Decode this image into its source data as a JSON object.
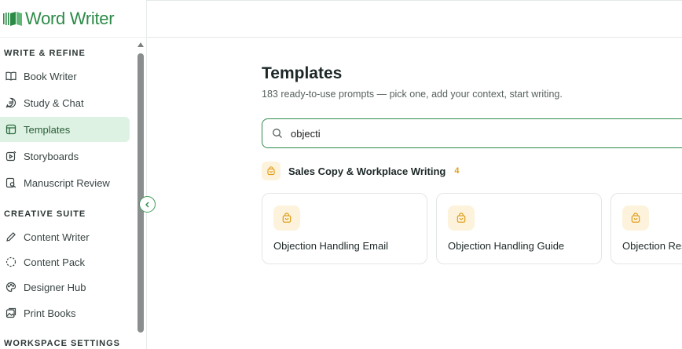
{
  "brand": {
    "name": "Word Writer",
    "color": "#2c8a47"
  },
  "sidebar": {
    "sections": [
      {
        "label": "WRITE & REFINE"
      },
      {
        "label": "CREATIVE SUITE"
      },
      {
        "label": "WORKSPACE SETTINGS"
      }
    ],
    "items": [
      {
        "label": "Book Writer",
        "icon": "book-open-icon"
      },
      {
        "label": "Study & Chat",
        "icon": "chat-bubble-icon"
      },
      {
        "label": "Templates",
        "icon": "layout-template-icon",
        "active": true
      },
      {
        "label": "Storyboards",
        "icon": "storyboard-icon"
      },
      {
        "label": "Manuscript Review",
        "icon": "document-review-icon"
      },
      {
        "label": "Content Writer",
        "icon": "pencil-icon"
      },
      {
        "label": "Content Pack",
        "icon": "dashed-circle-icon"
      },
      {
        "label": "Designer Hub",
        "icon": "palette-icon"
      },
      {
        "label": "Print Books",
        "icon": "image-stack-icon"
      }
    ]
  },
  "main": {
    "title": "Templates",
    "subtitle": "183 ready-to-use prompts — pick one, add your context, start writing.",
    "search": {
      "value": "objecti",
      "placeholder": ""
    },
    "category": {
      "name": "Sales Copy & Workplace Writing",
      "count": "4"
    },
    "cards": [
      {
        "title": "Objection Handling Email"
      },
      {
        "title": "Objection Handling Guide"
      },
      {
        "title": "Objection Res"
      }
    ]
  },
  "colors": {
    "accent": "#2c8a47",
    "active_bg": "#ddf2e2",
    "category_icon_bg": "#fdf3dc",
    "count": "#e0a020"
  }
}
